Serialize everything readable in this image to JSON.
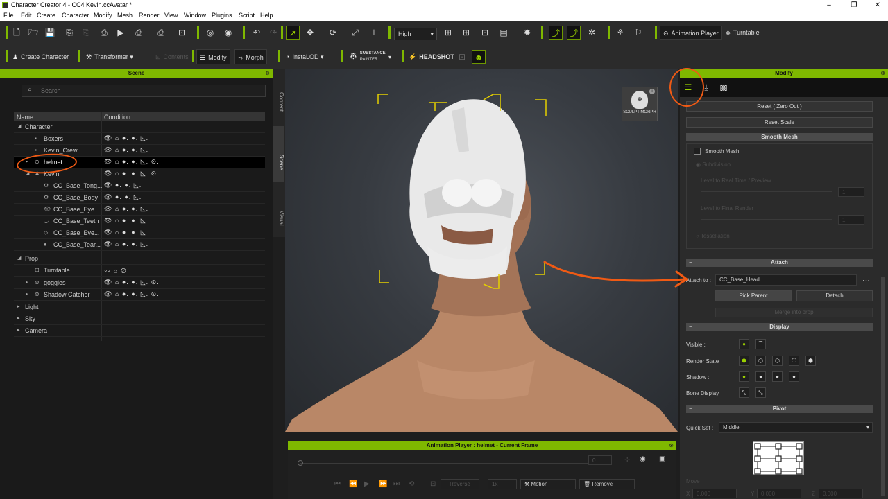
{
  "window": {
    "title": "Character Creator 4 - CC4 Kevin.ccAvatar *",
    "controls": [
      "–",
      "❐",
      "✕"
    ]
  },
  "menu": [
    "File",
    "Edit",
    "Create",
    "Character",
    "Modify",
    "Mesh",
    "Render",
    "View",
    "Window",
    "Plugins",
    "Script",
    "Help"
  ],
  "toolbar1": {
    "quality": "High",
    "animation_player": "Animation Player",
    "turntable": "Turntable"
  },
  "toolbar2": {
    "create_character": "Create Character",
    "transformer": "Transformer",
    "contents": "Contents",
    "modify": "Modify",
    "morph": "Morph",
    "instalod": "InstaLOD",
    "substance_top": "SUBSTANCE",
    "substance_bottom": "PAINTER",
    "headshot": "HEADSHOT"
  },
  "scene": {
    "title": "Scene",
    "search_placeholder": "Search",
    "columns": [
      "Name",
      "Condition"
    ],
    "rows": [
      {
        "label": "Character",
        "icon": "",
        "exp": "◢"
      },
      {
        "label": "Boxers",
        "icon": "▪",
        "exp": ""
      },
      {
        "label": "Kevin_Crew",
        "icon": "▪",
        "exp": ""
      },
      {
        "label": "helmet",
        "icon": "⊙",
        "exp": "▸"
      },
      {
        "label": "Kevin",
        "icon": "♟",
        "exp": "◢"
      },
      {
        "label": "CC_Base_Tong...",
        "icon": "⚙",
        "exp": ""
      },
      {
        "label": "CC_Base_Body",
        "icon": "⚙",
        "exp": ""
      },
      {
        "label": "CC_Base_Eye",
        "icon": "👁",
        "exp": ""
      },
      {
        "label": "CC_Base_Teeth",
        "icon": "◡",
        "exp": ""
      },
      {
        "label": "CC_Base_Eye...",
        "icon": "◇",
        "exp": ""
      },
      {
        "label": "CC_Base_Tear...",
        "icon": "♦",
        "exp": ""
      },
      {
        "label": "Prop",
        "icon": "",
        "exp": "◢"
      },
      {
        "label": "Turntable",
        "icon": "⊡",
        "exp": ""
      },
      {
        "label": "goggles",
        "icon": "⊛",
        "exp": "▸"
      },
      {
        "label": "Shadow Catcher",
        "icon": "⊛",
        "exp": "▸"
      },
      {
        "label": "Light",
        "icon": "",
        "exp": "▸"
      },
      {
        "label": "Sky",
        "icon": "",
        "exp": "▸"
      },
      {
        "label": "Camera",
        "icon": "",
        "exp": "▸"
      }
    ],
    "side_tabs": [
      "Content",
      "Scene",
      "Visual"
    ]
  },
  "viewport": {
    "sculpt_morph": "SCULPT MORPH"
  },
  "anim_player": {
    "title": "Animation Player : helmet - Current Frame",
    "frame": "0",
    "reverse": "Reverse",
    "speed": "1x",
    "motion": "Motion",
    "remove": "Remove"
  },
  "modify": {
    "title": "Modify",
    "reset_zero": "Reset ( Zero Out )",
    "reset_scale": "Reset Scale",
    "smooth_mesh": {
      "header": "Smooth Mesh",
      "checkbox": "Smooth Mesh",
      "subdivision": "Subdivision",
      "level_realtime": "Level to Real Time / Preview",
      "level_final": "Level to Final Render",
      "tessellation": "Tessellation",
      "val1": "1",
      "val2": "1"
    },
    "attach": {
      "header": "Attach",
      "label": "Attach to :",
      "value": "CC_Base_Head",
      "pick_parent": "Pick Parent",
      "detach": "Detach",
      "merge": "Merge into prop"
    },
    "display": {
      "header": "Display",
      "visible": "Visible :",
      "render_state": "Render State :",
      "shadow": "Shadow :",
      "bone_display": "Bone Display"
    },
    "pivot": {
      "header": "Pivot",
      "quick_set_label": "Quick Set :",
      "quick_set_value": "Middle",
      "move": "Move",
      "x": "X",
      "y": "Y",
      "z": "Z",
      "xv": "0.000",
      "yv": "0.000",
      "zv": "0.000"
    }
  },
  "accent": "#7fb800",
  "annotation_color": "#f05a14"
}
